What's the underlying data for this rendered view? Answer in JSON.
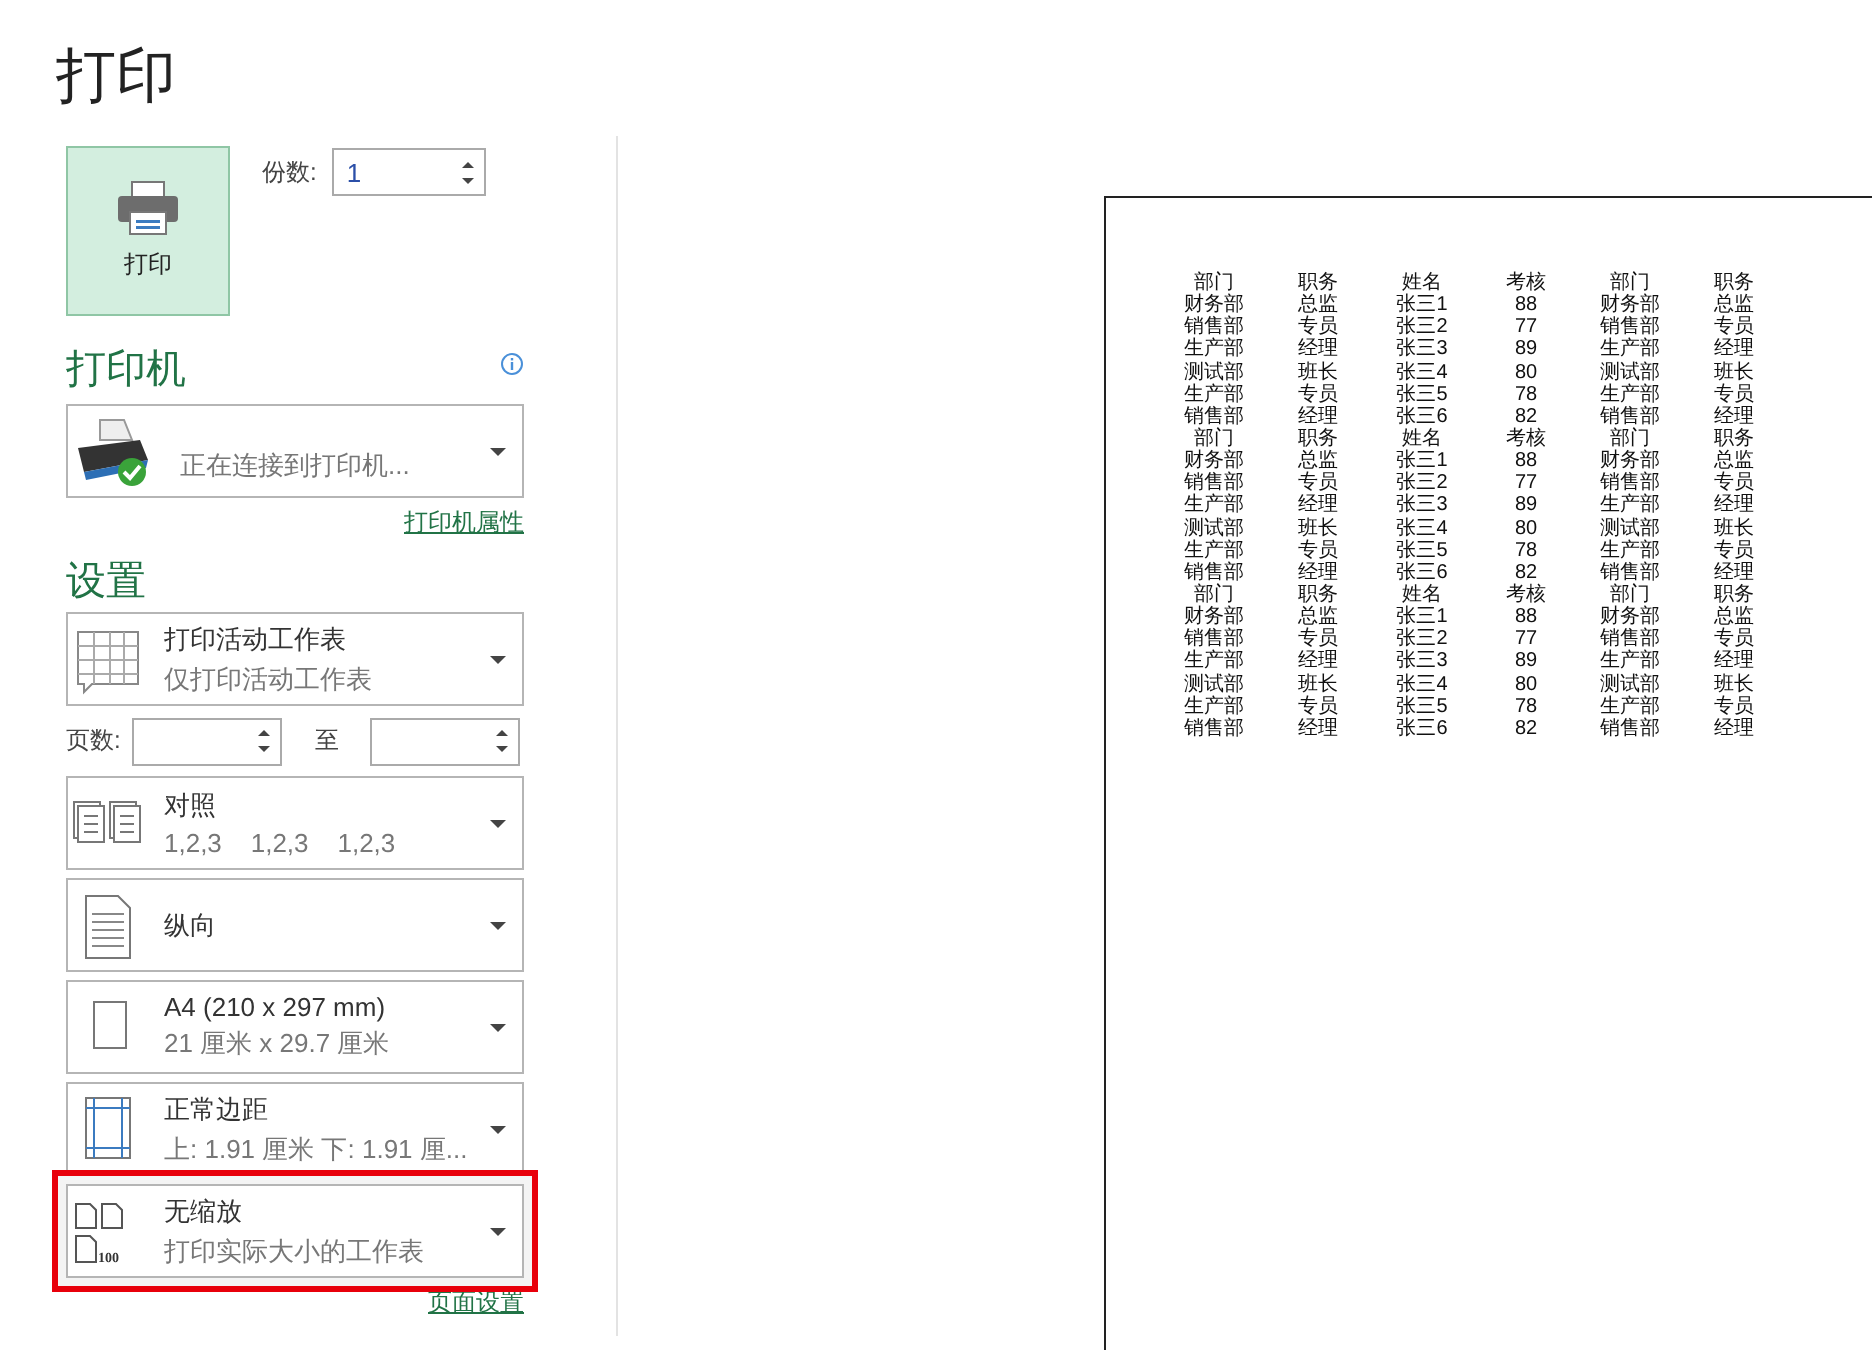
{
  "title": "打印",
  "print_button": {
    "label": "打印"
  },
  "copies": {
    "label": "份数:",
    "value": "1"
  },
  "printer": {
    "heading": "打印机",
    "status": "正在连接到打印机...",
    "link": "打印机属性"
  },
  "settings": {
    "heading": "设置",
    "items": [
      {
        "kind": "sheet",
        "title": "打印活动工作表",
        "subtitle": "仅打印活动工作表",
        "highlighted": false
      },
      {
        "kind": "pages",
        "label": "页数:",
        "to": "至"
      },
      {
        "kind": "collate",
        "title": "对照",
        "subtitle": "1,2,3    1,2,3    1,2,3",
        "highlighted": false
      },
      {
        "kind": "portrait",
        "title": "纵向",
        "highlighted": false
      },
      {
        "kind": "paper",
        "title": "A4 (210 x 297 mm)",
        "subtitle": "21 厘米 x 29.7 厘米",
        "highlighted": false
      },
      {
        "kind": "margins",
        "title": "正常边距",
        "subtitle": "上: 1.91 厘米 下: 1.91 厘...",
        "highlighted": false
      },
      {
        "kind": "scaling",
        "title": "无缩放",
        "subtitle": "打印实际大小的工作表",
        "icon_text": "100",
        "highlighted": true
      }
    ],
    "link": "页面设置"
  },
  "preview": {
    "rows": [
      [
        "部门",
        "职务",
        "姓名",
        "考核",
        "部门",
        "职务"
      ],
      [
        "财务部",
        "总监",
        "张三1",
        "88",
        "财务部",
        "总监"
      ],
      [
        "销售部",
        "专员",
        "张三2",
        "77",
        "销售部",
        "专员"
      ],
      [
        "生产部",
        "经理",
        "张三3",
        "89",
        "生产部",
        "经理"
      ],
      [
        "测试部",
        "班长",
        "张三4",
        "80",
        "测试部",
        "班长"
      ],
      [
        "生产部",
        "专员",
        "张三5",
        "78",
        "生产部",
        "专员"
      ],
      [
        "销售部",
        "经理",
        "张三6",
        "82",
        "销售部",
        "经理"
      ],
      [
        "部门",
        "职务",
        "姓名",
        "考核",
        "部门",
        "职务"
      ],
      [
        "财务部",
        "总监",
        "张三1",
        "88",
        "财务部",
        "总监"
      ],
      [
        "销售部",
        "专员",
        "张三2",
        "77",
        "销售部",
        "专员"
      ],
      [
        "生产部",
        "经理",
        "张三3",
        "89",
        "生产部",
        "经理"
      ],
      [
        "测试部",
        "班长",
        "张三4",
        "80",
        "测试部",
        "班长"
      ],
      [
        "生产部",
        "专员",
        "张三5",
        "78",
        "生产部",
        "专员"
      ],
      [
        "销售部",
        "经理",
        "张三6",
        "82",
        "销售部",
        "经理"
      ],
      [
        "部门",
        "职务",
        "姓名",
        "考核",
        "部门",
        "职务"
      ],
      [
        "财务部",
        "总监",
        "张三1",
        "88",
        "财务部",
        "总监"
      ],
      [
        "销售部",
        "专员",
        "张三2",
        "77",
        "销售部",
        "专员"
      ],
      [
        "生产部",
        "经理",
        "张三3",
        "89",
        "生产部",
        "经理"
      ],
      [
        "测试部",
        "班长",
        "张三4",
        "80",
        "测试部",
        "班长"
      ],
      [
        "生产部",
        "专员",
        "张三5",
        "78",
        "生产部",
        "专员"
      ],
      [
        "销售部",
        "经理",
        "张三6",
        "82",
        "销售部",
        "经理"
      ]
    ]
  }
}
